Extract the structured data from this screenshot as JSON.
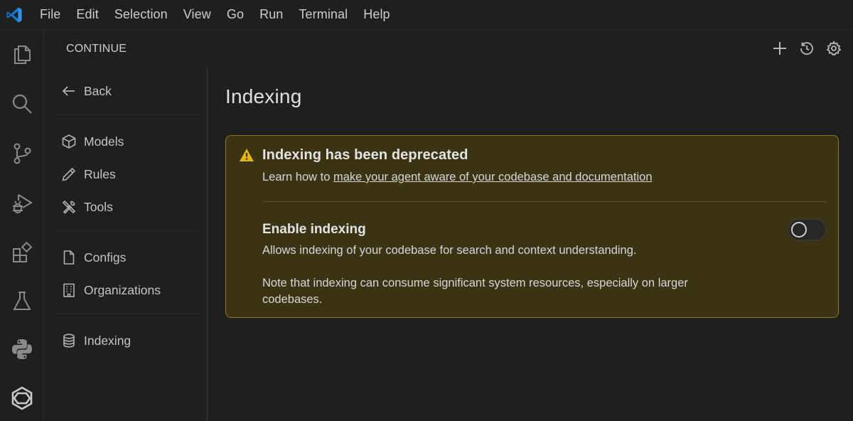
{
  "menu": [
    "File",
    "Edit",
    "Selection",
    "View",
    "Go",
    "Run",
    "Terminal",
    "Help"
  ],
  "panel": {
    "title": "CONTINUE",
    "actions": [
      "plus-icon",
      "history-icon",
      "gear-icon"
    ]
  },
  "nav": {
    "back": "Back",
    "items": [
      {
        "label": "Models",
        "icon": "cube-icon"
      },
      {
        "label": "Rules",
        "icon": "pencil-icon"
      },
      {
        "label": "Tools",
        "icon": "tools-icon"
      },
      {
        "label": "Configs",
        "icon": "file-icon"
      },
      {
        "label": "Organizations",
        "icon": "building-icon"
      },
      {
        "label": "Indexing",
        "icon": "database-icon"
      }
    ]
  },
  "main": {
    "title": "Indexing",
    "warning": {
      "title": "Indexing has been deprecated",
      "text_prefix": "Learn how to ",
      "link": "make your agent aware of your codebase and documentation"
    },
    "setting": {
      "label": "Enable indexing",
      "description": "Allows indexing of your codebase for search and context understanding.",
      "note": "Note that indexing can consume significant system resources, especially on larger codebases.",
      "enabled": false
    }
  },
  "colors": {
    "accent": "#0078d4",
    "warning_bg": "#3a3414",
    "warning_border": "#8c7a12",
    "warning_icon": "#e2b714"
  }
}
